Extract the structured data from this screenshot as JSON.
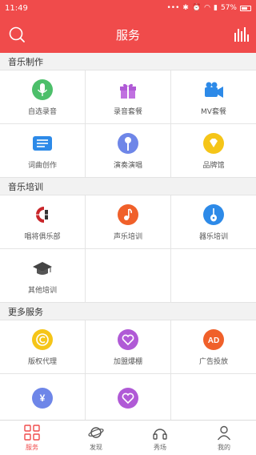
{
  "status": {
    "time": "11:49",
    "battery": "57%"
  },
  "header": {
    "title": "服务"
  },
  "sections": [
    {
      "title": "音乐制作",
      "items": [
        "自选录音",
        "录音套餐",
        "MV套餐",
        "词曲创作",
        "演奏演唱",
        "品牌馆"
      ]
    },
    {
      "title": "音乐培训",
      "items": [
        "唱将俱乐部",
        "声乐培训",
        "器乐培训",
        "其他培训"
      ]
    },
    {
      "title": "更多服务",
      "items": [
        "版权代理",
        "加盟爆棚",
        "广告投放"
      ]
    }
  ],
  "extra_icons": {
    "yuan": "¥",
    "ad": "AD"
  },
  "tabs": [
    "服务",
    "发现",
    "秀场",
    "我的"
  ],
  "colors": {
    "primary": "#f04b4b"
  }
}
